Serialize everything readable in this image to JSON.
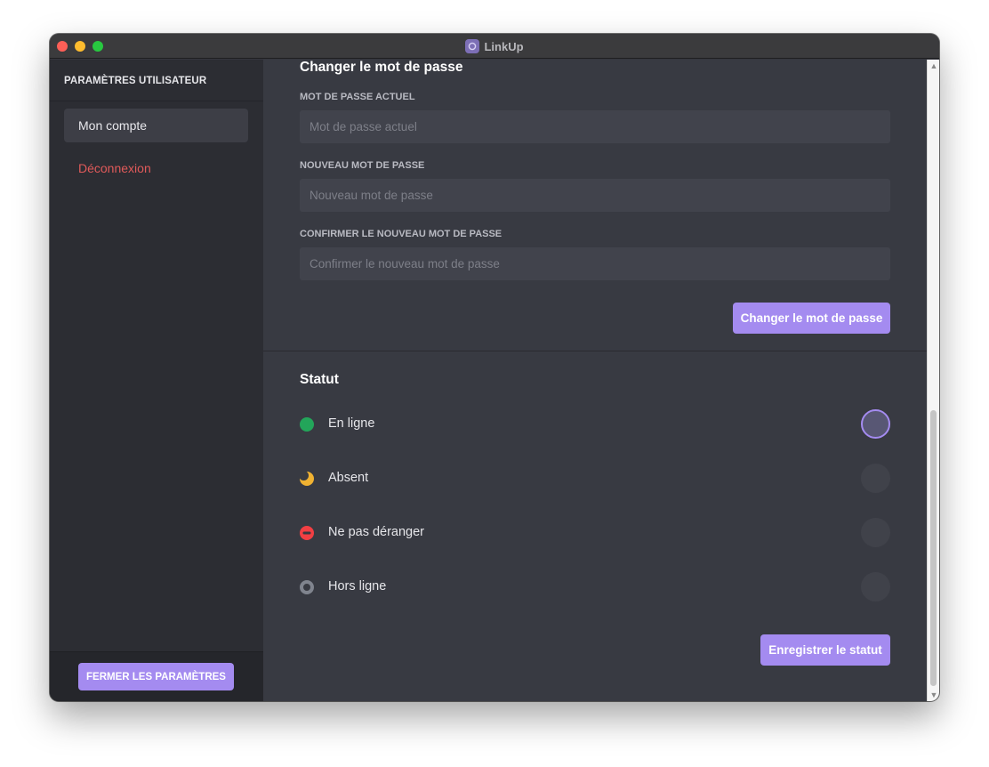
{
  "window": {
    "title": "LinkUp"
  },
  "sidebar": {
    "header": "PARAMÈTRES UTILISATEUR",
    "items": [
      {
        "label": "Mon compte",
        "active": true
      },
      {
        "label": "Déconnexion",
        "color": "#e05a5a"
      }
    ],
    "close_button": "FERMER LES PARAMÈTRES"
  },
  "password": {
    "title": "Changer le mot de passe",
    "current_label": "MOT DE PASSE ACTUEL",
    "current_placeholder": "Mot de passe actuel",
    "new_label": "NOUVEAU MOT DE PASSE",
    "new_placeholder": "Nouveau mot de passe",
    "confirm_label": "CONFIRMER LE NOUVEAU MOT DE PASSE",
    "confirm_placeholder": "Confirmer le nouveau mot de passe",
    "submit": "Changer le mot de passe"
  },
  "status": {
    "title": "Statut",
    "options": [
      {
        "label": "En ligne",
        "icon": "online-dot-icon",
        "color": "#23a55a",
        "selected": true
      },
      {
        "label": "Absent",
        "icon": "moon-icon",
        "color": "#f0b232",
        "selected": false
      },
      {
        "label": "Ne pas déranger",
        "icon": "do-not-disturb-icon",
        "color": "#f23f43",
        "selected": false
      },
      {
        "label": "Hors ligne",
        "icon": "offline-ring-icon",
        "color": "#80848e",
        "selected": false
      }
    ],
    "save": "Enregistrer le statut"
  },
  "colors": {
    "accent": "#a48bf0",
    "sidebar": "#2c2d33",
    "main": "#383a42",
    "danger": "#e05a5a"
  }
}
